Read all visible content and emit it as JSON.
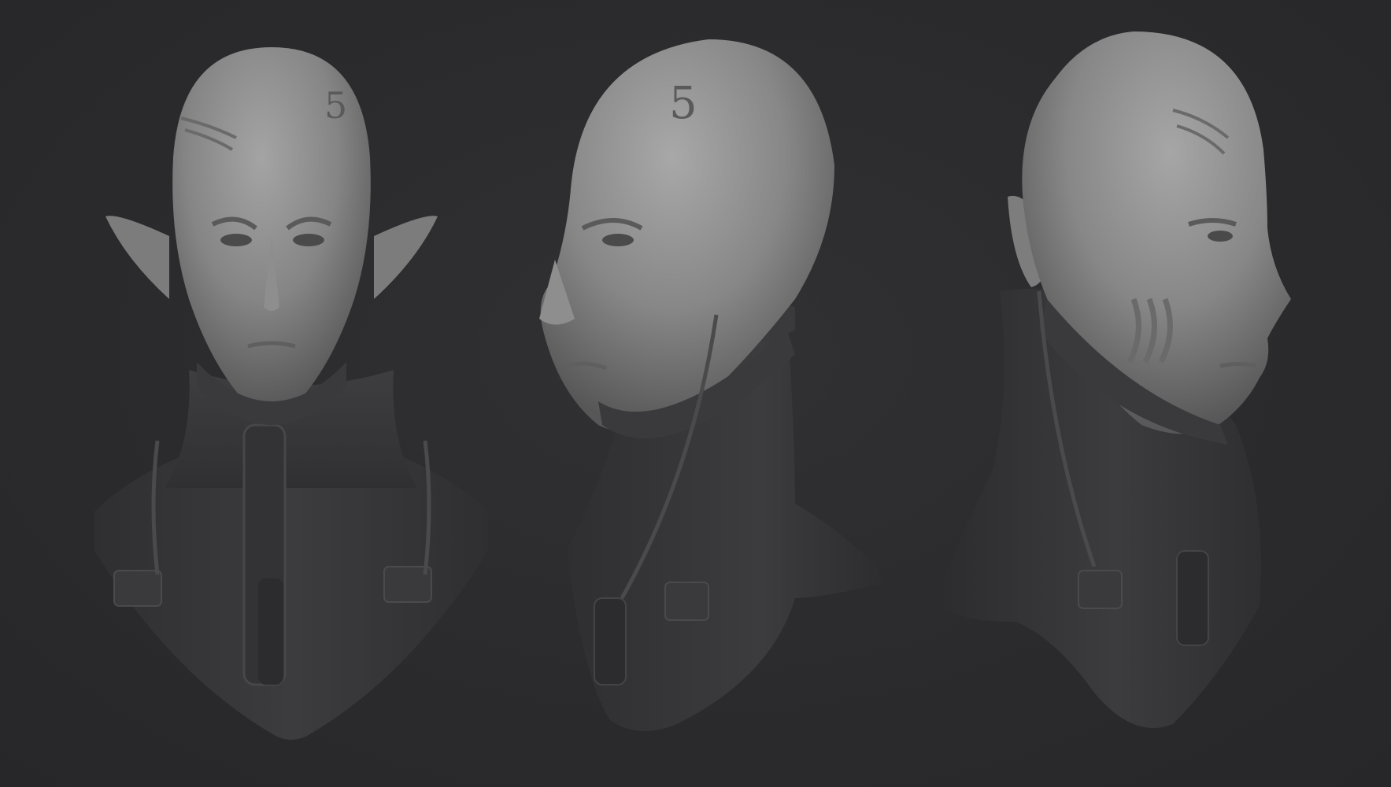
{
  "scene": {
    "background_color": "#2b2b2d",
    "material_color": "#8a8a8a",
    "collar_color": "#3a3a3c",
    "views": [
      {
        "id": "front",
        "forehead_glyph": "5"
      },
      {
        "id": "three-quarter-left",
        "forehead_glyph": "5"
      },
      {
        "id": "profile-right",
        "forehead_glyph": ""
      }
    ]
  }
}
